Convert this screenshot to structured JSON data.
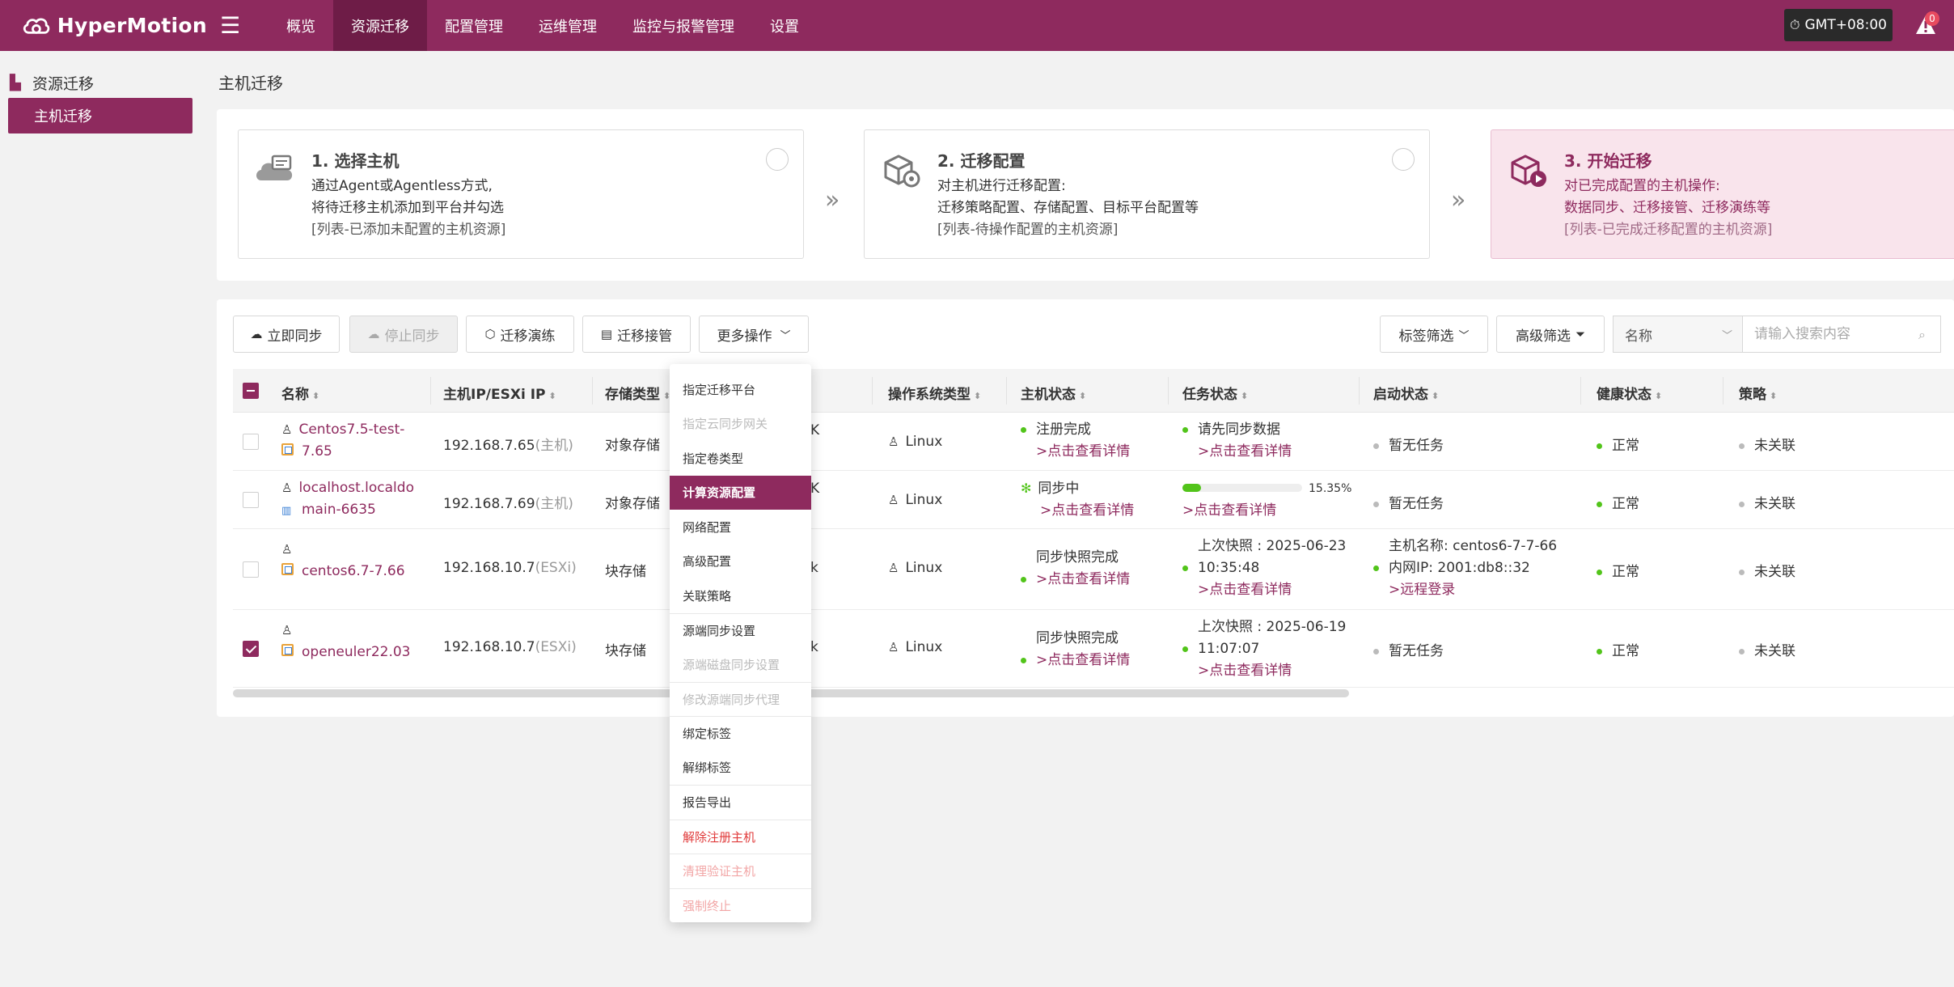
{
  "app": {
    "name": "HyperMotion"
  },
  "nav": {
    "items": [
      "概览",
      "资源迁移",
      "配置管理",
      "运维管理",
      "监控与报警管理",
      "设置"
    ],
    "active": "资源迁移"
  },
  "header": {
    "timezone": "GMT+08:00",
    "alert_count": "0"
  },
  "sidebar": {
    "group": "资源迁移",
    "items": [
      {
        "label": "主机迁移"
      }
    ]
  },
  "page": {
    "title": "主机迁移"
  },
  "steps": [
    {
      "title": "1. 选择主机",
      "lines": [
        "通过Agent或Agentless方式,",
        "将待迁移主机添加到平台并勾选"
      ],
      "note": "[列表-已添加未配置的主机资源]"
    },
    {
      "title": "2. 迁移配置",
      "lines": [
        "对主机进行迁移配置:",
        "迁移策略配置、存储配置、目标平台配置等"
      ],
      "note": "[列表-待操作配置的主机资源]"
    },
    {
      "title": "3. 开始迁移",
      "lines": [
        "对已完成配置的主机操作:",
        "数据同步、迁移接管、迁移演练等"
      ],
      "note": "[列表-已完成迁移配置的主机资源]"
    }
  ],
  "toolbar": {
    "sync_now": "立即同步",
    "stop_sync": "停止同步",
    "drill": "迁移演练",
    "takeover": "迁移接管",
    "more": "更多操作",
    "tag_filter": "标签筛选",
    "advanced_filter": "高级筛选",
    "search_field": "名称",
    "search_placeholder": "请输入搜索内容"
  },
  "table": {
    "headers": [
      "名称",
      "主机IP/ESXi IP",
      "存储类型",
      "操作系统类型",
      "主机状态",
      "任务状态",
      "启动状态",
      "健康状态",
      "策略"
    ],
    "rows": [
      {
        "name1": "Centos7.5-test-",
        "name2": "7.65",
        "ip": "192.168.7.65",
        "ip_type": "(主机)",
        "storage": "对象存储",
        "storage_tail": "K",
        "os": "Linux",
        "host_status": "注册完成",
        "host_link": ">点击查看详情",
        "task_line1": "请先同步数据",
        "task_link": ">点击查看详情",
        "boot": "暂无任务",
        "health": "正常",
        "policy": "未关联"
      },
      {
        "name1": "localhost.localdo",
        "name2": "main-6635",
        "ip": "192.168.7.69",
        "ip_type": "(主机)",
        "storage": "对象存储",
        "storage_tail": "K",
        "os": "Linux",
        "host_status": "同步中",
        "host_link": ">点击查看详情",
        "task_progress": 15.35,
        "task_progress_text": "15.35%",
        "task_link": ">点击查看详情",
        "boot": "暂无任务",
        "health": "正常",
        "policy": "未关联"
      },
      {
        "name1": "centos6.7-7.66",
        "ip": "192.168.10.7",
        "ip_type": "(ESXi)",
        "storage": "块存储",
        "storage_tail": "k",
        "os": "Linux",
        "host_status": "同步快照完成",
        "host_link": ">点击查看详情",
        "task_line1": "上次快照 : 2025-06-23",
        "task_line2": "10:35:48",
        "task_link": ">点击查看详情",
        "boot_line1": "主机名称: centos6-7-7-66",
        "boot_line2": "内网IP: 2001:db8::32",
        "boot_link": ">远程登录",
        "health": "正常",
        "policy": "未关联"
      },
      {
        "name1": "openeuler22.03",
        "ip": "192.168.10.7",
        "ip_type": "(ESXi)",
        "storage": "块存储",
        "storage_tail": "k",
        "os": "Linux",
        "host_status": "同步快照完成",
        "host_link": ">点击查看详情",
        "task_line1": "上次快照 : 2025-06-19",
        "task_line2": "11:07:07",
        "task_link": ">点击查看详情",
        "boot": "暂无任务",
        "health": "正常",
        "policy": "未关联"
      }
    ]
  },
  "dropdown": {
    "items": [
      {
        "label": "指定迁移平台",
        "state": "normal"
      },
      {
        "label": "指定云同步网关",
        "state": "disabled"
      },
      {
        "label": "指定卷类型",
        "state": "normal"
      },
      {
        "label": "计算资源配置",
        "state": "active"
      },
      {
        "label": "网络配置",
        "state": "normal"
      },
      {
        "label": "高级配置",
        "state": "normal"
      },
      {
        "label": "关联策略",
        "state": "normal"
      },
      {
        "label": "源端同步设置",
        "state": "normal"
      },
      {
        "label": "源端磁盘同步设置",
        "state": "disabled"
      },
      {
        "label": "修改源端同步代理",
        "state": "disabled"
      },
      {
        "label": "绑定标签",
        "state": "normal"
      },
      {
        "label": "解绑标签",
        "state": "normal"
      },
      {
        "label": "报告导出",
        "state": "normal"
      },
      {
        "label": "解除注册主机",
        "state": "danger"
      },
      {
        "label": "清理验证主机",
        "state": "danger-disabled"
      },
      {
        "label": "强制终止",
        "state": "danger-disabled"
      }
    ]
  },
  "colors": {
    "brand": "#8e2a5e",
    "brand_dark": "#6e1c47",
    "success": "#52c41a",
    "danger": "#e03a3a"
  }
}
